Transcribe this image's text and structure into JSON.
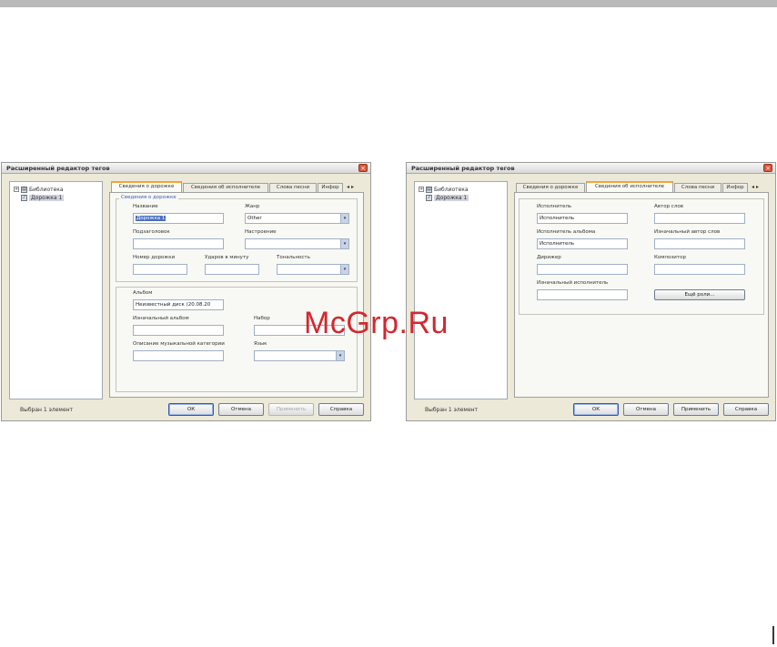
{
  "watermark": "McGrp.Ru",
  "left_dialog": {
    "title": "Расширенный редактор тегов",
    "tree": [
      {
        "toggle": "+",
        "label": "Библиотека"
      },
      {
        "toggle": "−",
        "label": "Дорожка 1"
      }
    ],
    "tabs": [
      "Сведения о дорожке",
      "Сведения об исполнителе",
      "Слова песни",
      "Инфор"
    ],
    "tab_arrows": "◂ ▸",
    "group_title": "Сведения о дорожке",
    "fields": {
      "title_label": "Название",
      "title_value": "Дорожка 1",
      "genre_label": "Жанр",
      "genre_value": "Other",
      "subtitle_label": "Подзаголовок",
      "mood_label": "Настроение",
      "track_number_label": "Номер дорожки",
      "rating_label": "Ударов в минуту",
      "key_label": "Тональность",
      "album_label": "Альбом",
      "album_value": "Неизвестный диск (20.08.20",
      "original_album_label": "Изначальный альбом",
      "set_label": "Набор",
      "content_group_label": "Описание музыкальной категории",
      "language_label": "Язык"
    },
    "status": "Выбран 1 элемент",
    "buttons": {
      "ok": "ОК",
      "cancel": "Отмена",
      "apply": "Применить",
      "help": "Справка"
    }
  },
  "right_dialog": {
    "title": "Расширенный редактор тегов",
    "tree": [
      {
        "toggle": "+",
        "label": "Библиотека"
      },
      {
        "toggle": "−",
        "label": "Дорожка 1"
      }
    ],
    "tabs": [
      "Сведения о дорожке",
      "Сведения об исполнителе",
      "Слова песни",
      "Инфор"
    ],
    "tab_arrows": "◂ ▸",
    "fields": {
      "artist_label": "Исполнитель",
      "artist_value": "Исполнитель",
      "lyricist_label": "Автор слов",
      "album_artist_label": "Исполнитель альбома",
      "album_artist_value": "Исполнитель",
      "original_lyricist_label": "Изначальный автор слов",
      "conductor_label": "Дирижер",
      "composer_label": "Композитор",
      "original_artist_label": "Изначальный исполнитель",
      "more_button": "Ещё роли..."
    },
    "status": "Выбран 1 элемент",
    "buttons": {
      "ok": "ОК",
      "cancel": "Отмена",
      "apply": "Применить",
      "help": "Справка"
    }
  }
}
